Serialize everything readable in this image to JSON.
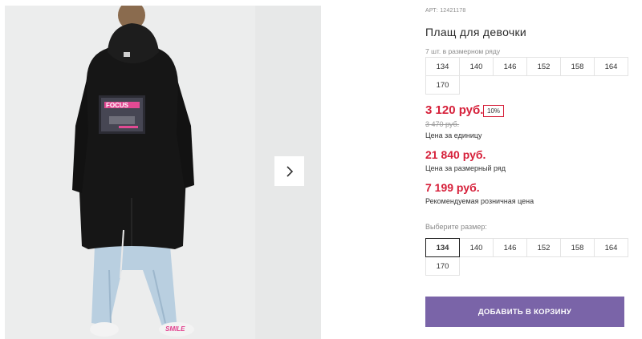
{
  "product": {
    "article": "АРТ: 12421178",
    "title": "Плащ для девочки",
    "image_alt": "girl-coat-photo",
    "print_text": "FOCUS",
    "shoe_text": "SMILE"
  },
  "gallery": {
    "next_icon": "chevron-right-icon"
  },
  "pack": {
    "label": "7 шт. в размерном ряду",
    "sizes": [
      "134",
      "140",
      "146",
      "152",
      "158",
      "164",
      "170"
    ]
  },
  "pricing": {
    "price": "3 120 руб.",
    "discount": "10%",
    "old_price": "3 470 руб.",
    "unit_label": "Цена за единицу",
    "pack_price": "21 840 руб.",
    "pack_price_label": "Цена за размерный ряд",
    "rrp": "7 199 руб.",
    "rrp_label": "Рекомендуемая розничная цена"
  },
  "size_select": {
    "label": "Выберите размер:",
    "selected": "134",
    "sizes": [
      "134",
      "140",
      "146",
      "152",
      "158",
      "164",
      "170"
    ]
  },
  "cart": {
    "add_label": "ДОБАВИТЬ В КОРЗИНУ"
  },
  "colors": {
    "price": "#d6203a",
    "button": "#7a64a8"
  }
}
